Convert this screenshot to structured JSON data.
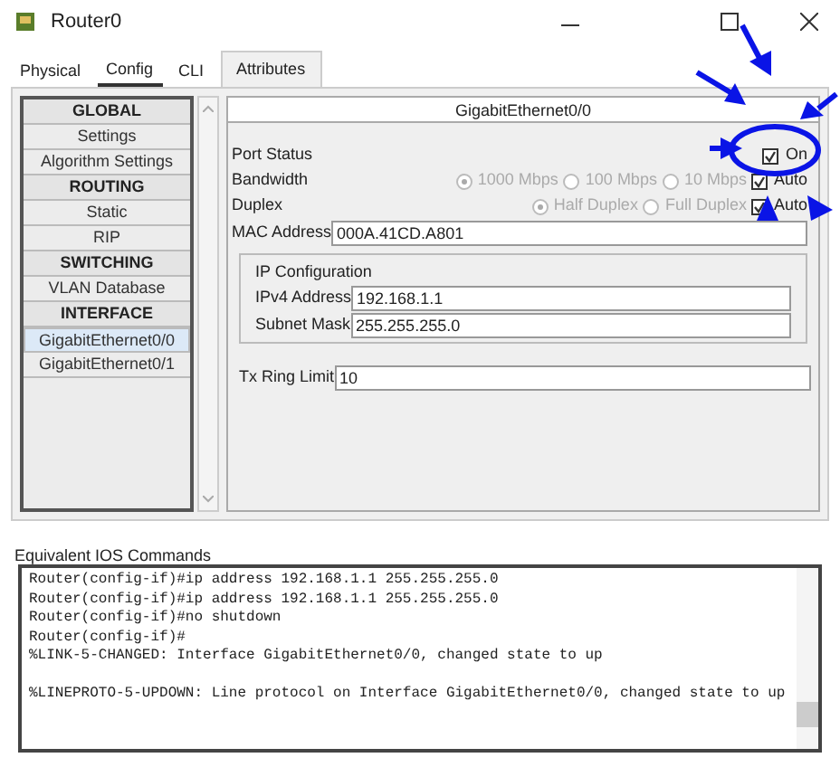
{
  "window": {
    "title": "Router0"
  },
  "tabs": [
    {
      "label": "Physical",
      "selected": false
    },
    {
      "label": "Config",
      "selected": true
    },
    {
      "label": "CLI",
      "selected": false
    },
    {
      "label": "Attributes",
      "selected": false
    }
  ],
  "sidebar": {
    "items": [
      {
        "kind": "header",
        "label": "GLOBAL",
        "selected": false
      },
      {
        "kind": "item",
        "label": "Settings",
        "selected": false
      },
      {
        "kind": "item",
        "label": "Algorithm Settings",
        "selected": false
      },
      {
        "kind": "header",
        "label": "ROUTING",
        "selected": false
      },
      {
        "kind": "item",
        "label": "Static",
        "selected": false
      },
      {
        "kind": "item",
        "label": "RIP",
        "selected": false
      },
      {
        "kind": "header",
        "label": "SWITCHING",
        "selected": false
      },
      {
        "kind": "item",
        "label": "VLAN Database",
        "selected": false
      },
      {
        "kind": "header",
        "label": "INTERFACE",
        "selected": false
      },
      {
        "kind": "item",
        "label": "GigabitEthernet0/0",
        "selected": true
      },
      {
        "kind": "item",
        "label": "GigabitEthernet0/1",
        "selected": false
      }
    ]
  },
  "panel": {
    "title": "GigabitEthernet0/0",
    "port_status": {
      "label": "Port Status",
      "checkbox_label": "On",
      "checked": true
    },
    "bandwidth": {
      "label": "Bandwidth",
      "disabled": true,
      "options": [
        {
          "label": "1000 Mbps",
          "selected": true
        },
        {
          "label": "100 Mbps",
          "selected": false
        },
        {
          "label": "10 Mbps",
          "selected": false
        }
      ],
      "auto": {
        "label": "Auto",
        "checked": true
      }
    },
    "duplex": {
      "label": "Duplex",
      "disabled": true,
      "options": [
        {
          "label": "Half Duplex",
          "selected": true
        },
        {
          "label": "Full Duplex",
          "selected": false
        }
      ],
      "auto": {
        "label": "Auto",
        "checked": true
      }
    },
    "mac": {
      "label": "MAC Address",
      "value": "000A.41CD.A801"
    },
    "ip_config": {
      "title": "IP Configuration",
      "fields": [
        {
          "label": "IPv4 Address",
          "value": "192.168.1.1"
        },
        {
          "label": "Subnet Mask",
          "value": "255.255.255.0"
        }
      ]
    },
    "tx_ring": {
      "label": "Tx Ring Limit",
      "value": "10"
    }
  },
  "console": {
    "label": "Equivalent IOS Commands",
    "paragraphs": [
      [
        "Router(config-if)#ip address 192.168.1.1 255.255.255.0",
        "Router(config-if)#ip address 192.168.1.1 255.255.255.0",
        "Router(config-if)#no shutdown",
        "Router(config-if)#",
        "%LINK-5-CHANGED: Interface GigabitEthernet0/0, changed state to up"
      ],
      [
        "%LINEPROTO-5-UPDOWN: Line protocol on Interface GigabitEthernet0/0, changed state to up"
      ]
    ]
  }
}
